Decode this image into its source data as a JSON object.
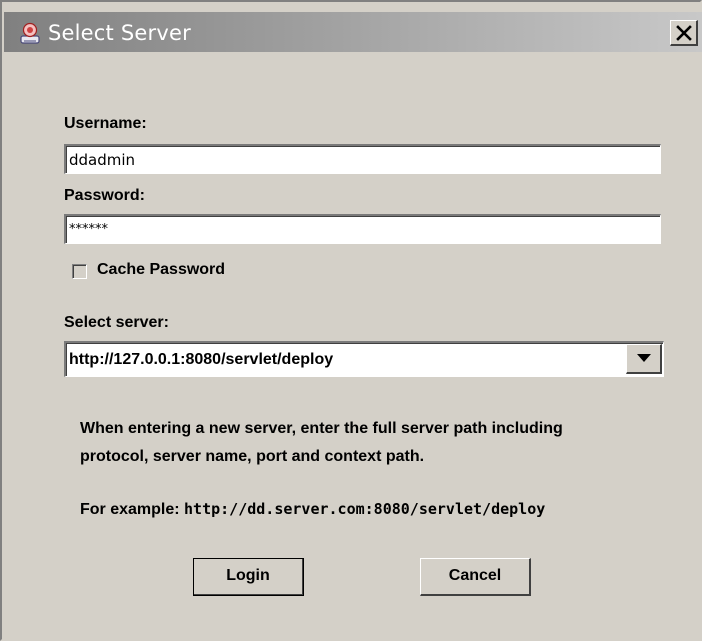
{
  "window": {
    "title": "Select Server",
    "close_label": "close"
  },
  "form": {
    "username_label": "Username:",
    "username_value": "ddadmin",
    "password_label": "Password:",
    "password_value": "******",
    "cache_password_label": "Cache Password",
    "cache_password_checked": false,
    "select_server_label": "Select server:",
    "server_value": "http://127.0.0.1:8080/servlet/deploy"
  },
  "info": {
    "line1": "When entering a new server, enter the full server path including",
    "line2": "protocol, server name, port and context path.",
    "example_prefix": "For example: ",
    "example_url": "http://dd.server.com:8080/servlet/deploy"
  },
  "buttons": {
    "login": "Login",
    "cancel": "Cancel"
  },
  "icons": {
    "app": "java-app-icon",
    "close": "close-icon",
    "dropdown": "chevron-down-icon"
  }
}
